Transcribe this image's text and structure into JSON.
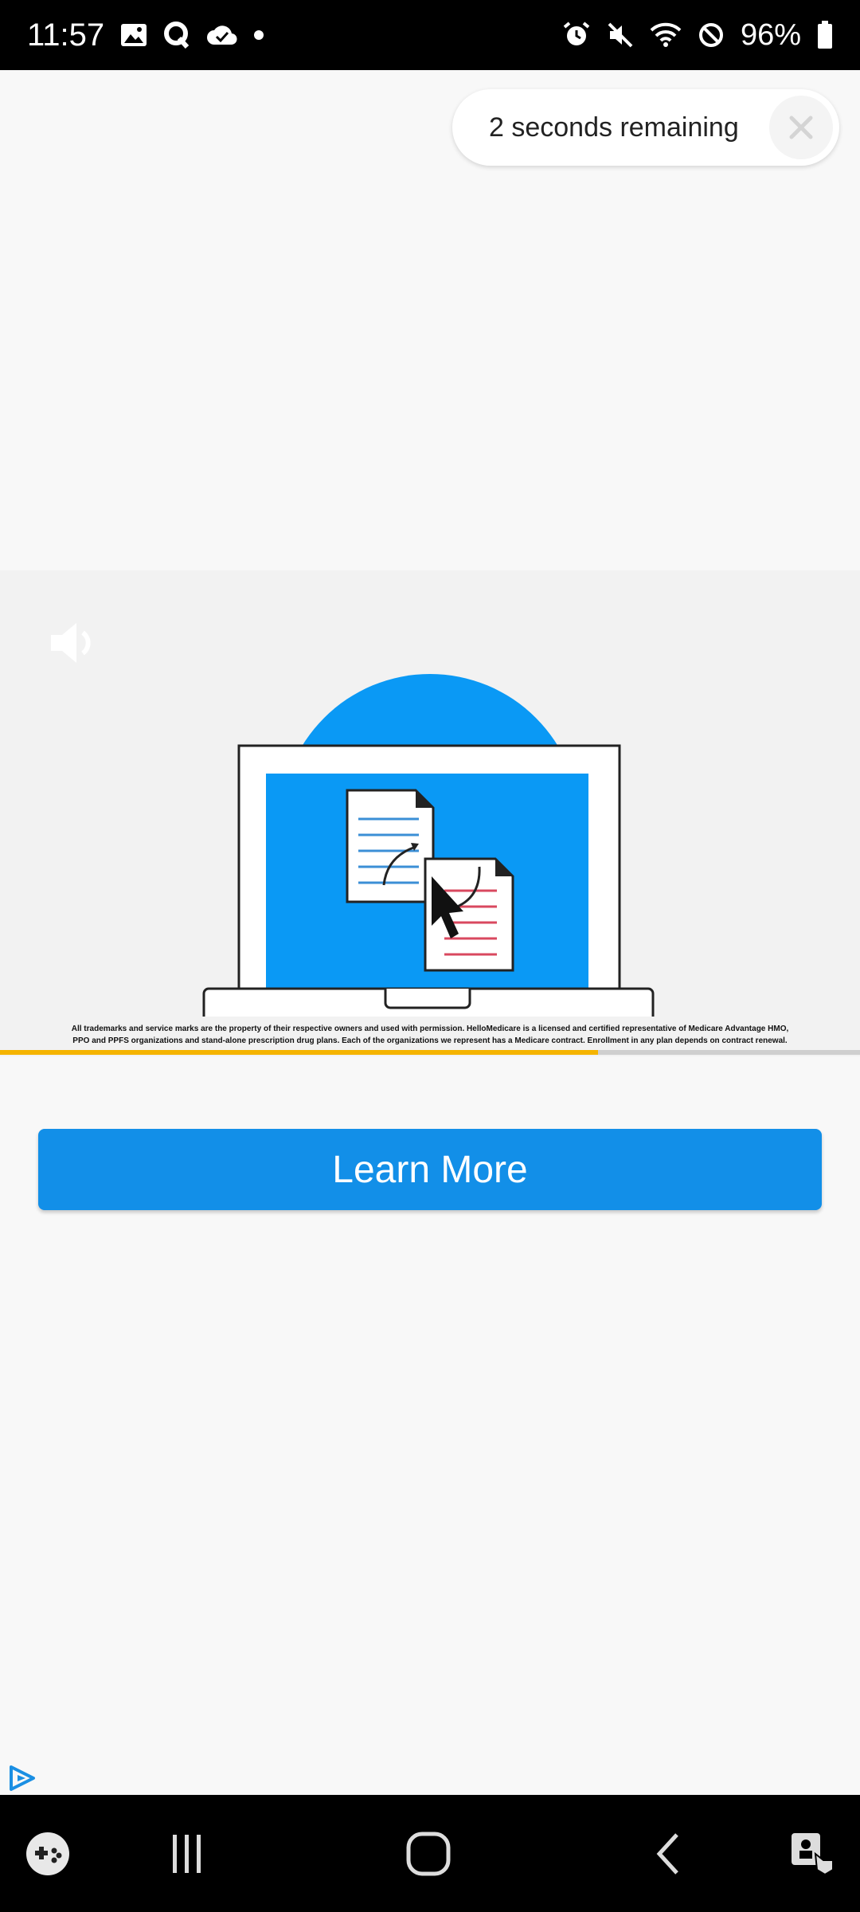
{
  "status_bar": {
    "time": "11:57",
    "battery": "96%",
    "icons_left": [
      "image-icon",
      "q-app-icon",
      "cloud-check-icon",
      "dot-icon"
    ],
    "icons_right": [
      "alarm-icon",
      "mute-icon",
      "wifi-icon",
      "do-not-disturb-icon"
    ]
  },
  "ad": {
    "timer_text": "2 seconds remaining",
    "close_icon": "close-icon",
    "disclaimer_line1": "All trademarks and service marks are the property of their respective owners and used with permission. HelloMedicare is a licensed and certified representative of Medicare Advantage HMO,",
    "disclaimer_line2": "PPO and PPFS organizations and stand-alone prescription drug plans. Each of the organizations we represent has a Medicare contract. Enrollment in any plan depends on contract renewal.",
    "video_progress": 0.695,
    "cta_label": "Learn More",
    "colors": {
      "cta": "#128fe8",
      "progress": "#f5b400",
      "illustration_blue": "#0a99f5"
    }
  },
  "nav_bar": {
    "items": [
      "game-launcher-icon",
      "recents-icon",
      "home-icon",
      "back-icon",
      "accessibility-icon"
    ]
  }
}
